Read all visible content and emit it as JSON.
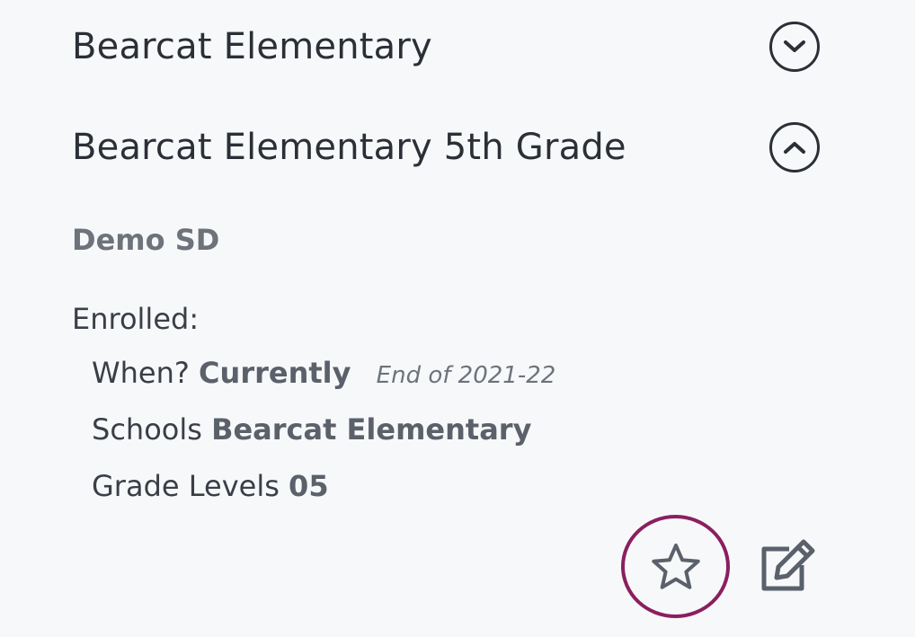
{
  "groups": [
    {
      "title": "Bearcat Elementary",
      "expanded": false,
      "toggle_icon": "chevron-down-icon"
    },
    {
      "title": "Bearcat Elementary 5th Grade",
      "expanded": true,
      "toggle_icon": "chevron-up-icon"
    }
  ],
  "detail": {
    "organization": "Demo SD",
    "enrolled_label": "Enrolled:",
    "when_label": "When?",
    "when_value": "Currently",
    "when_note": "End of 2021-22",
    "schools_label": "Schools",
    "schools_value": "Bearcat Elementary",
    "grade_levels_label": "Grade Levels",
    "grade_levels_value": "05"
  },
  "actions": {
    "favorite_icon": "star-outline-icon",
    "edit_icon": "edit-icon",
    "highlight_color": "#8a1f5f"
  },
  "colors": {
    "background": "#f7f8fa",
    "text_primary": "#2b2f36",
    "text_secondary": "#6d737b"
  }
}
